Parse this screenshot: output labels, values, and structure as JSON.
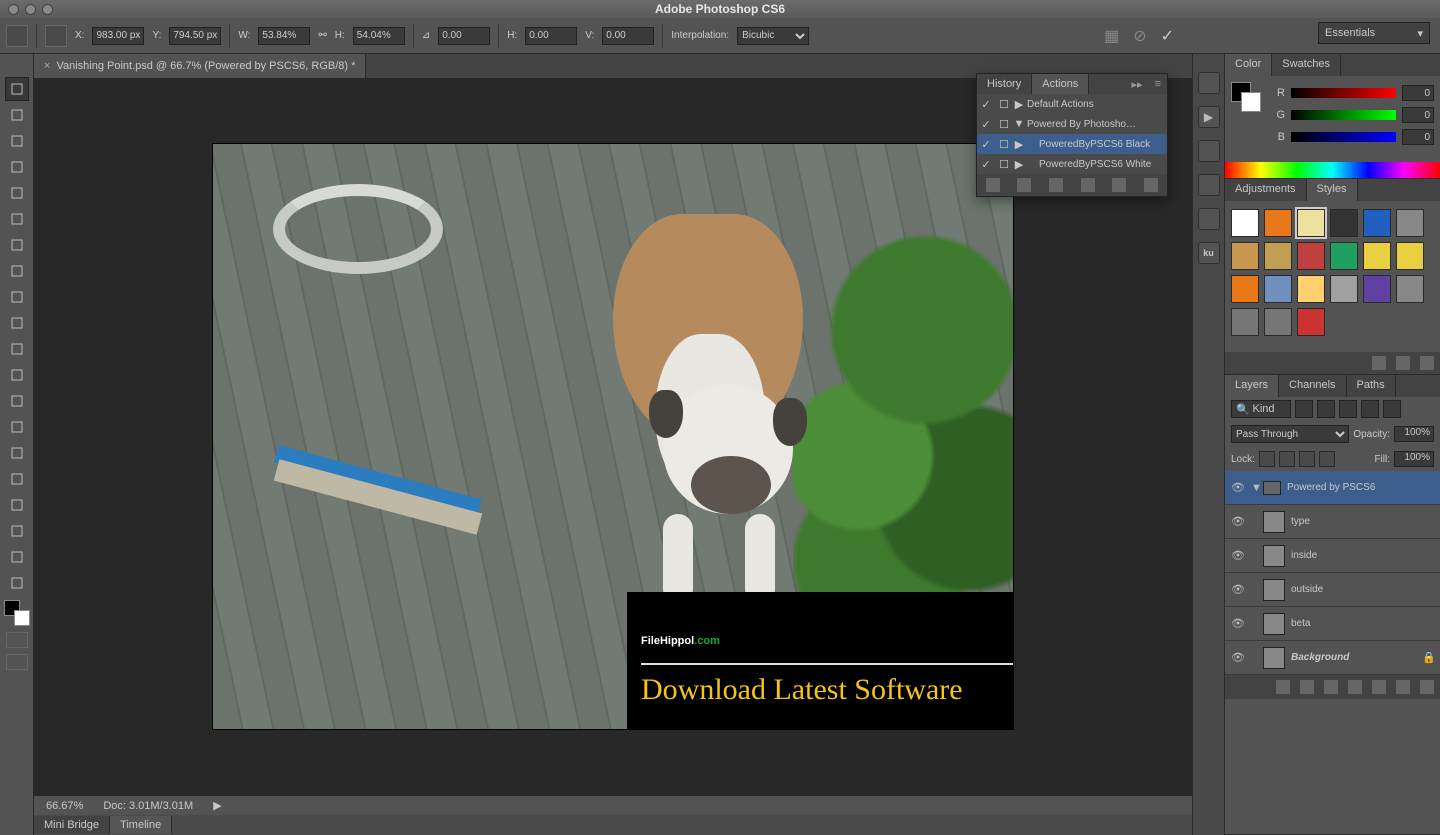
{
  "titlebar": {
    "title": "Adobe Photoshop CS6"
  },
  "workspace": {
    "label": "Essentials"
  },
  "optionbar": {
    "x_label": "X:",
    "x": "983.00 px",
    "y_label": "Y:",
    "y": "794.50 px",
    "w_label": "W:",
    "w": "53.84%",
    "h_label": "H:",
    "h": "54.04%",
    "angle_label": "⊿",
    "angle": "0.00",
    "skew_h_label": "H:",
    "skew_h": "0.00",
    "skew_v_label": "V:",
    "skew_v": "0.00",
    "interpolation_label": "Interpolation:",
    "interpolation": "Bicubic",
    "cancel_glyph": "⊘",
    "commit_glyph": "✓",
    "warp_glyph": "▦"
  },
  "document": {
    "tab_title": "Vanishing Point.psd @ 66.7% (Powered by PSCS6, RGB/8) *"
  },
  "statusbar": {
    "zoom": "66.67%",
    "doc": "Doc: 3.01M/3.01M"
  },
  "bottom_tabs": {
    "mini_bridge": "Mini Bridge",
    "timeline": "Timeline"
  },
  "banner": {
    "line1a": "FileHippol",
    "line1b": ".com",
    "line2": "Download Latest Software"
  },
  "actions_panel": {
    "tab_history": "History",
    "tab_actions": "Actions",
    "rows": [
      {
        "name": "Default Actions",
        "twirl": "▶"
      },
      {
        "name": "Powered By Photosho…",
        "twirl": "▼"
      },
      {
        "name": "PoweredByPSCS6 Black",
        "indent": 1,
        "selected": true,
        "twirl": "▶"
      },
      {
        "name": "PoweredByPSCS6 White",
        "indent": 1,
        "twirl": "▶"
      }
    ]
  },
  "color_panel": {
    "tab_color": "Color",
    "tab_swatches": "Swatches",
    "r_label": "R",
    "r_val": "0",
    "g_label": "G",
    "g_val": "0",
    "b_label": "B",
    "b_val": "0"
  },
  "styles_panel": {
    "tab_adjustments": "Adjustments",
    "tab_styles": "Styles",
    "swatches": [
      "#ffffff",
      "#e87818",
      "#f0e0a0",
      "#333333",
      "#2060c0",
      "#888888",
      "#c89850",
      "#c0a050",
      "#c04040",
      "#20a060",
      "#e8d040",
      "#e8d040",
      "#e87818",
      "#7090c0",
      "#ffd070",
      "#a0a0a0",
      "#6040a0",
      "#888888",
      "#777777",
      "#777777",
      "#cc3333"
    ]
  },
  "layers_panel": {
    "tab_layers": "Layers",
    "tab_channels": "Channels",
    "tab_paths": "Paths",
    "kind_label": "Kind",
    "mode": "Pass Through",
    "opacity_label": "Opacity:",
    "opacity": "100%",
    "lock_label": "Lock:",
    "fill_label": "Fill:",
    "fill": "100%",
    "layers": [
      {
        "name": "Powered by PSCS6",
        "group": true,
        "selected": true
      },
      {
        "name": "type"
      },
      {
        "name": "inside"
      },
      {
        "name": "outside"
      },
      {
        "name": "beta"
      },
      {
        "name": "Background",
        "bg": true
      }
    ]
  },
  "tool_names": [
    "move",
    "marquee",
    "lasso",
    "quick-select",
    "crop",
    "eyedropper",
    "healing",
    "brush",
    "clone",
    "history-brush",
    "eraser",
    "gradient",
    "blur",
    "dodge",
    "pen",
    "type",
    "path-select",
    "shape",
    "hand",
    "zoom"
  ]
}
